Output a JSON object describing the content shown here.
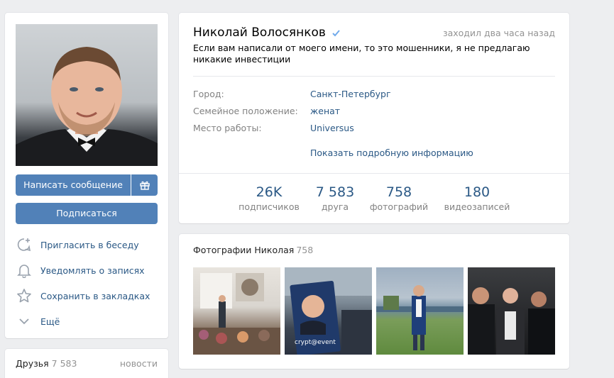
{
  "left": {
    "write_message": "Написать сообщение",
    "subscribe": "Подписаться",
    "actions": [
      {
        "label": "Пригласить в беседу",
        "icon": "chat-add-icon"
      },
      {
        "label": "Уведомлять о записях",
        "icon": "bell-icon"
      },
      {
        "label": "Сохранить в закладках",
        "icon": "star-icon"
      },
      {
        "label": "Ещё",
        "icon": "chevron-down-icon"
      }
    ]
  },
  "friends": {
    "title": "Друзья",
    "count": "7 583",
    "news": "новости"
  },
  "profile": {
    "name": "Николай Волосянков",
    "online": "заходил два часа назад",
    "status": "Если вам написали от моего имени, то это мошенники, я не предлагаю никакие инвестиции",
    "info": [
      {
        "key": "Город:",
        "value": "Санкт-Петербург"
      },
      {
        "key": "Семейное положение:",
        "value": "женат"
      },
      {
        "key": "Место работы:",
        "value": "Universus"
      }
    ],
    "more_info": "Показать подробную информацию",
    "stats": [
      {
        "num": "26K",
        "cap": "подписчиков"
      },
      {
        "num": "7 583",
        "cap": "друга"
      },
      {
        "num": "758",
        "cap": "фотографий"
      },
      {
        "num": "180",
        "cap": "видеозаписей"
      }
    ]
  },
  "photos": {
    "title": "Фотографии Николая",
    "count": "758",
    "photo2_text": "crypt@event"
  },
  "colors": {
    "accent": "#5181b8",
    "link": "#2a5885",
    "background": "#edeef0"
  }
}
